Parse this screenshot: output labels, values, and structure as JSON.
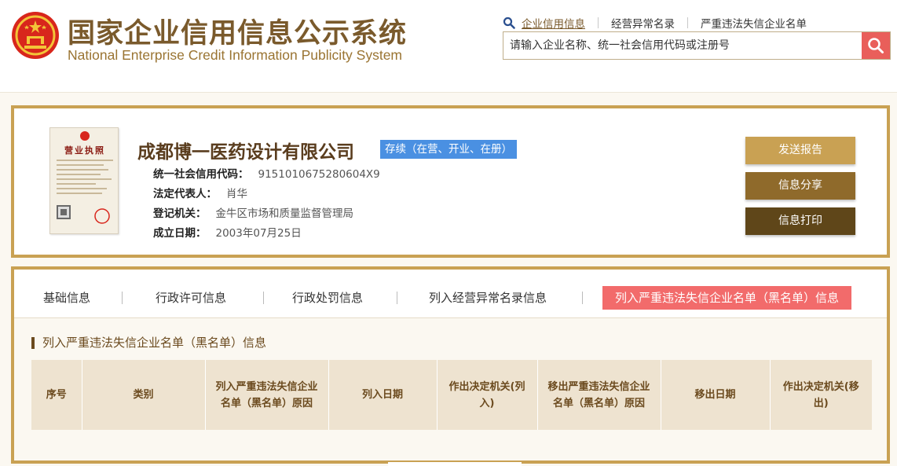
{
  "header": {
    "title_cn": "国家企业信用信息公示系统",
    "title_en": "National Enterprise Credit Information Publicity System",
    "nav_links": [
      {
        "label": "企业信用信息",
        "active": true
      },
      {
        "label": "经营异常名录",
        "active": false
      },
      {
        "label": "严重违法失信企业名单",
        "active": false
      }
    ],
    "search": {
      "placeholder": "请输入企业名称、统一社会信用代码或注册号"
    }
  },
  "company": {
    "license_title": "营业执照",
    "name": "成都博一医药设计有限公司",
    "status": "存续（在营、开业、在册）",
    "fields": [
      {
        "label": "统一社会信用代码：",
        "value": "9151010675280604X9"
      },
      {
        "label": "法定代表人：",
        "value": "肖华"
      },
      {
        "label": "登记机关：",
        "value": "金牛区市场和质量监督管理局"
      },
      {
        "label": "成立日期：",
        "value": "2003年07月25日"
      }
    ],
    "actions": {
      "report": "发送报告",
      "share": "信息分享",
      "print": "信息打印"
    }
  },
  "tabs": [
    {
      "label": "基础信息"
    },
    {
      "label": "行政许可信息"
    },
    {
      "label": "行政处罚信息"
    },
    {
      "label": "列入经营异常名录信息"
    },
    {
      "label": "列入严重违法失信企业名单（黑名单）信息"
    }
  ],
  "section": {
    "title": "列入严重违法失信企业名单（黑名单）信息",
    "columns": [
      "序号",
      "类别",
      "列入严重违法失信企业名单（黑名单）原因",
      "列入日期",
      "作出决定机关(列入)",
      "移出严重违法失信企业名单（黑名单）原因",
      "移出日期",
      "作出决定机关(移出)"
    ]
  },
  "colors": {
    "brand_brown": "#7a5a2c",
    "border_gold": "#c9a153",
    "status_blue": "#4a90e2",
    "active_tab_red": "#f26b6b",
    "search_red": "#e95f5a"
  }
}
